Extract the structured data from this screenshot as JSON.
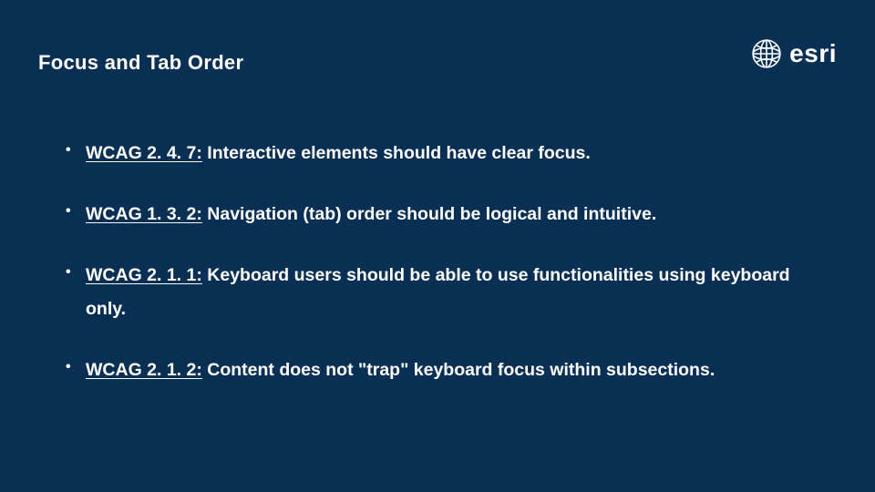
{
  "title": "Focus and Tab Order",
  "logo_text": "esri",
  "bullets": [
    {
      "link": "WCAG 2. 4. 7:",
      "text": " Interactive elements should have clear focus."
    },
    {
      "link": "WCAG 1. 3. 2:",
      "text": " Navigation (tab) order should be logical and intuitive."
    },
    {
      "link": "WCAG 2. 1. 1:",
      "text": " Keyboard users should be able to use functionalities using keyboard only."
    },
    {
      "link": "WCAG 2. 1. 2:",
      "text": " Content does not \"trap\" keyboard focus within subsections."
    }
  ]
}
